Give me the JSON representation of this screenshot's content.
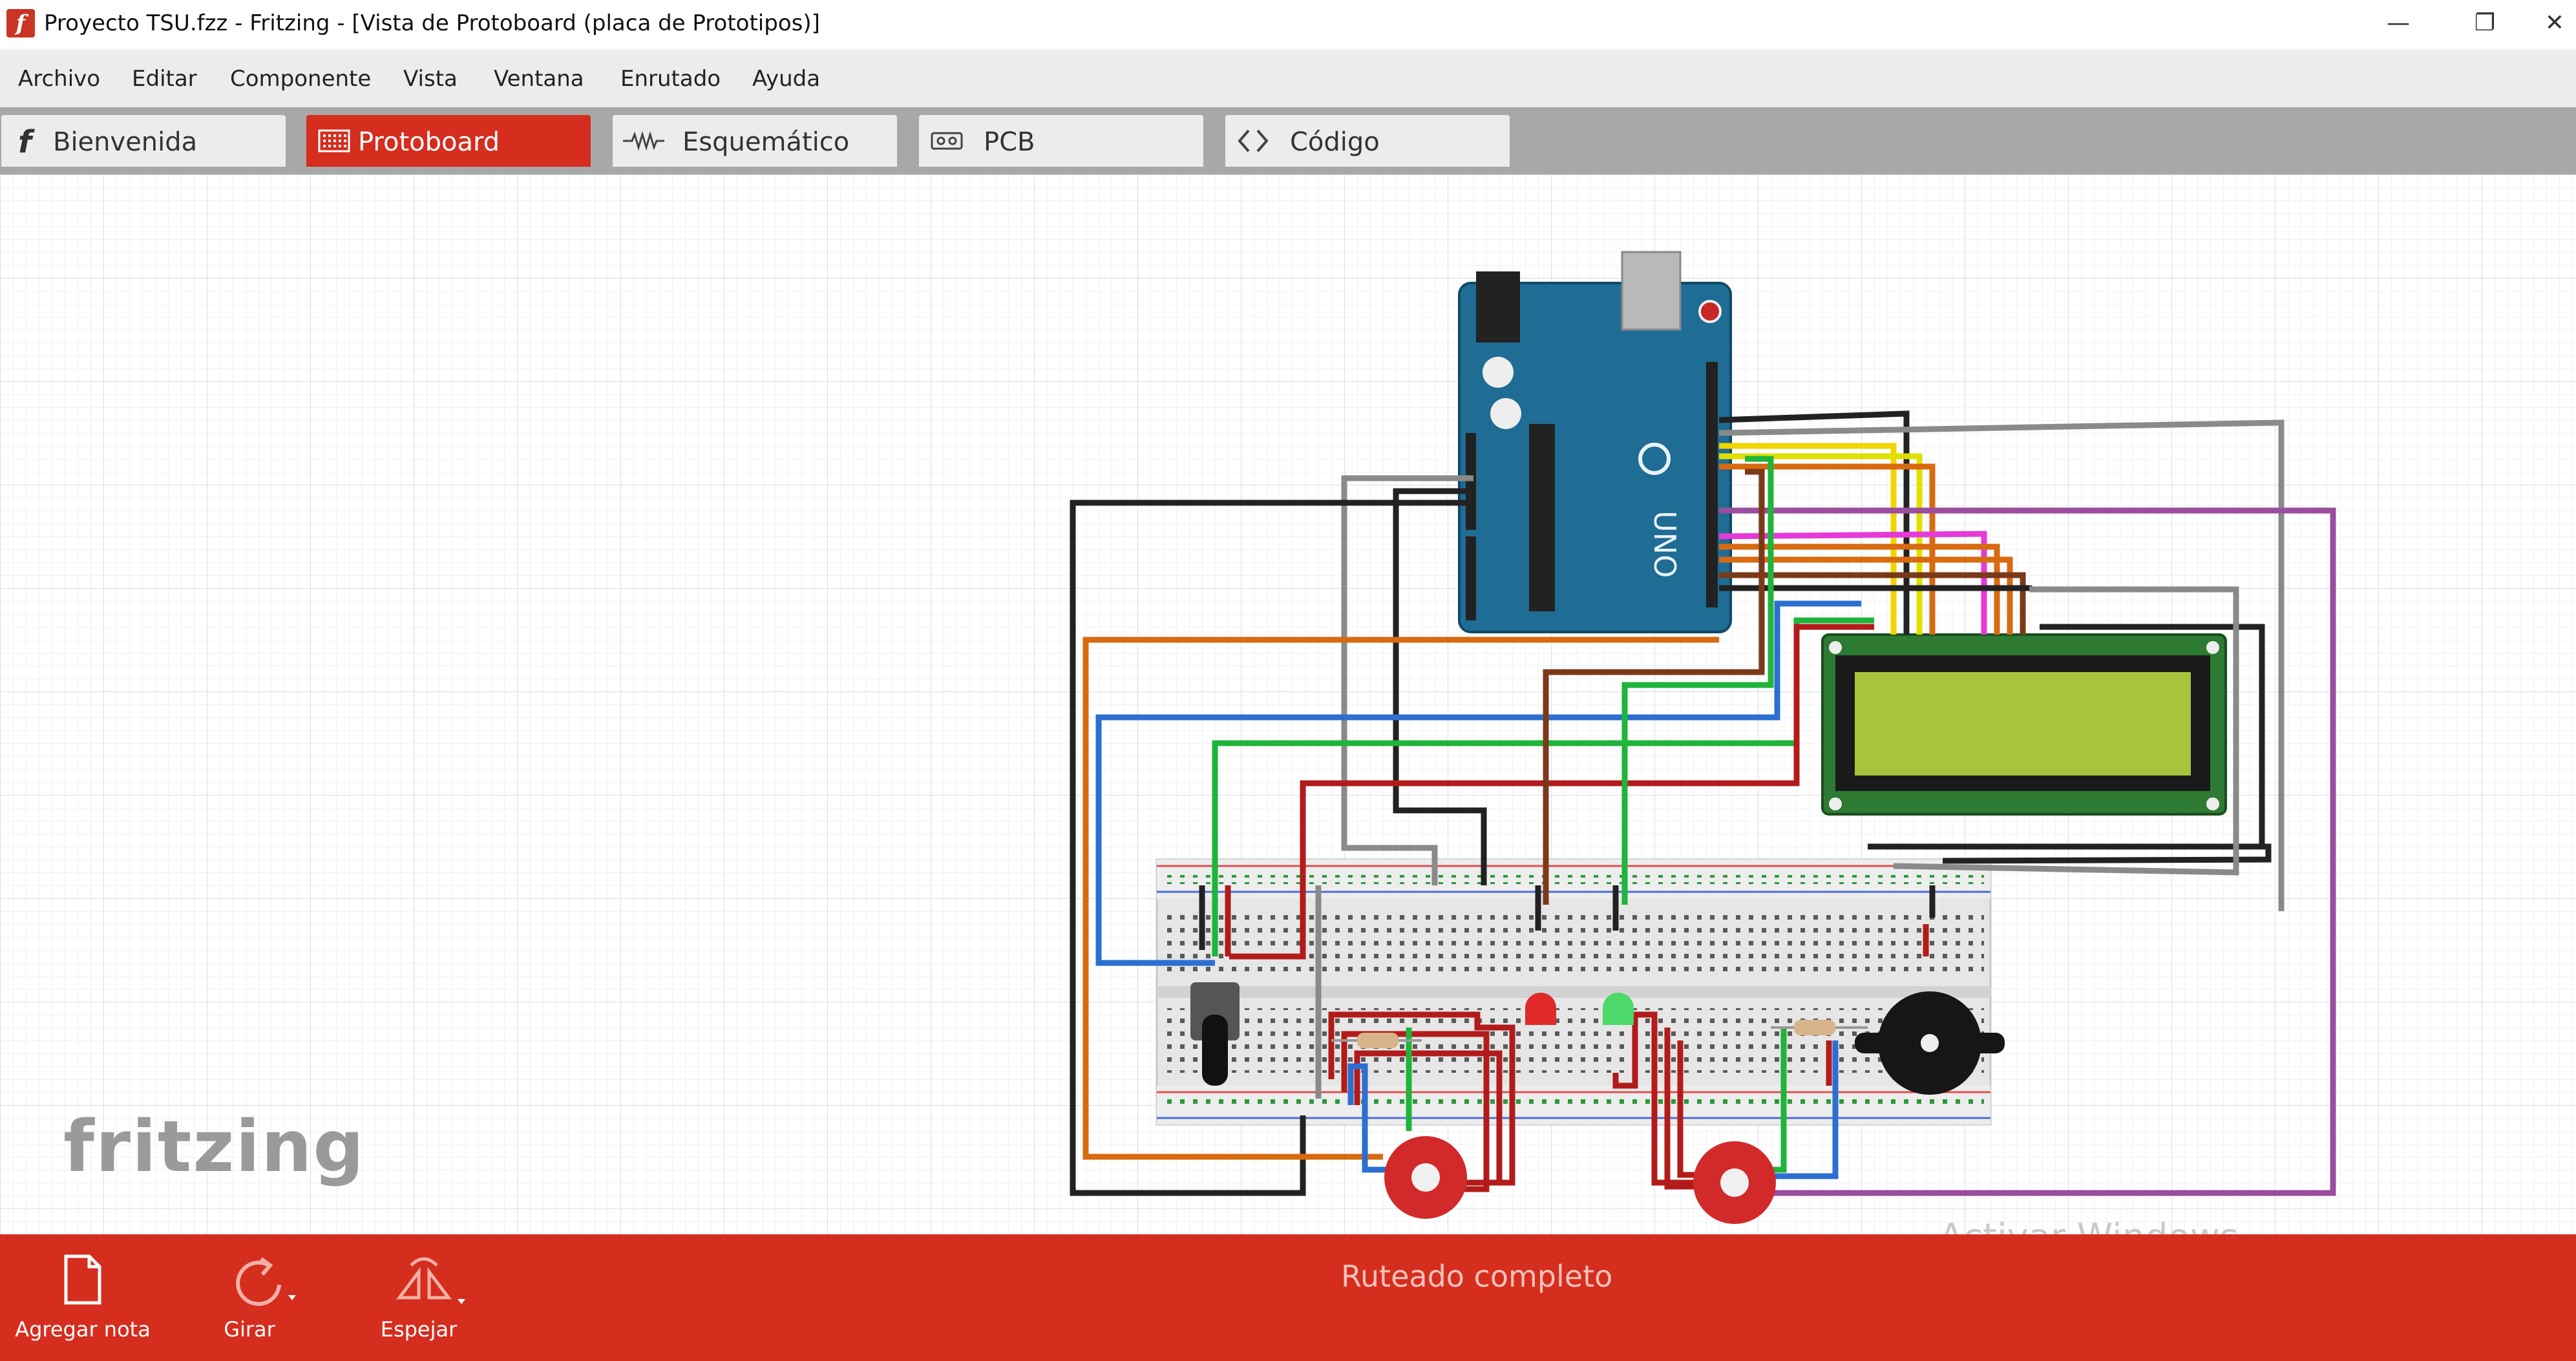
{
  "window": {
    "title": "Proyecto TSU.fzz - Fritzing - [Vista de Protoboard (placa de Prototipos)]",
    "app_icon": "fritzing-f-icon",
    "controls": [
      "minimize",
      "restore",
      "close"
    ]
  },
  "menu": [
    "Archivo",
    "Editar",
    "Componente",
    "Vista",
    "Ventana",
    "Enrutado",
    "Ayuda"
  ],
  "tabs": [
    {
      "label": "Bienvenida",
      "icon": "fritzing-f-icon",
      "active": false
    },
    {
      "label": "Protoboard",
      "icon": "breadboard-icon",
      "active": true
    },
    {
      "label": "Esquemático",
      "icon": "resistor-icon",
      "active": false
    },
    {
      "label": "PCB",
      "icon": "pcb-icon",
      "active": false
    },
    {
      "label": "Código",
      "icon": "code-icon",
      "active": false
    }
  ],
  "canvas": {
    "watermark": "fritzing",
    "components": [
      "Arduino UNO",
      "LCD 16x2",
      "breadboard",
      "potentiometer",
      "red LED",
      "green LED",
      "resistor",
      "resistor",
      "piezo buzzer",
      "sensor",
      "sensor"
    ],
    "arduino_label": "UNO",
    "activate_text": "Activar Windows"
  },
  "bottombar": {
    "tools": [
      {
        "label": "Agregar nota",
        "icon": "note-icon"
      },
      {
        "label": "Girar",
        "icon": "rotate-icon"
      },
      {
        "label": "Espejar",
        "icon": "mirror-icon"
      }
    ],
    "status": "Ruteado completo"
  },
  "colors": {
    "accent": "#d52d1e",
    "tabbar": "#a8a8a8",
    "menubar": "#ececec"
  }
}
